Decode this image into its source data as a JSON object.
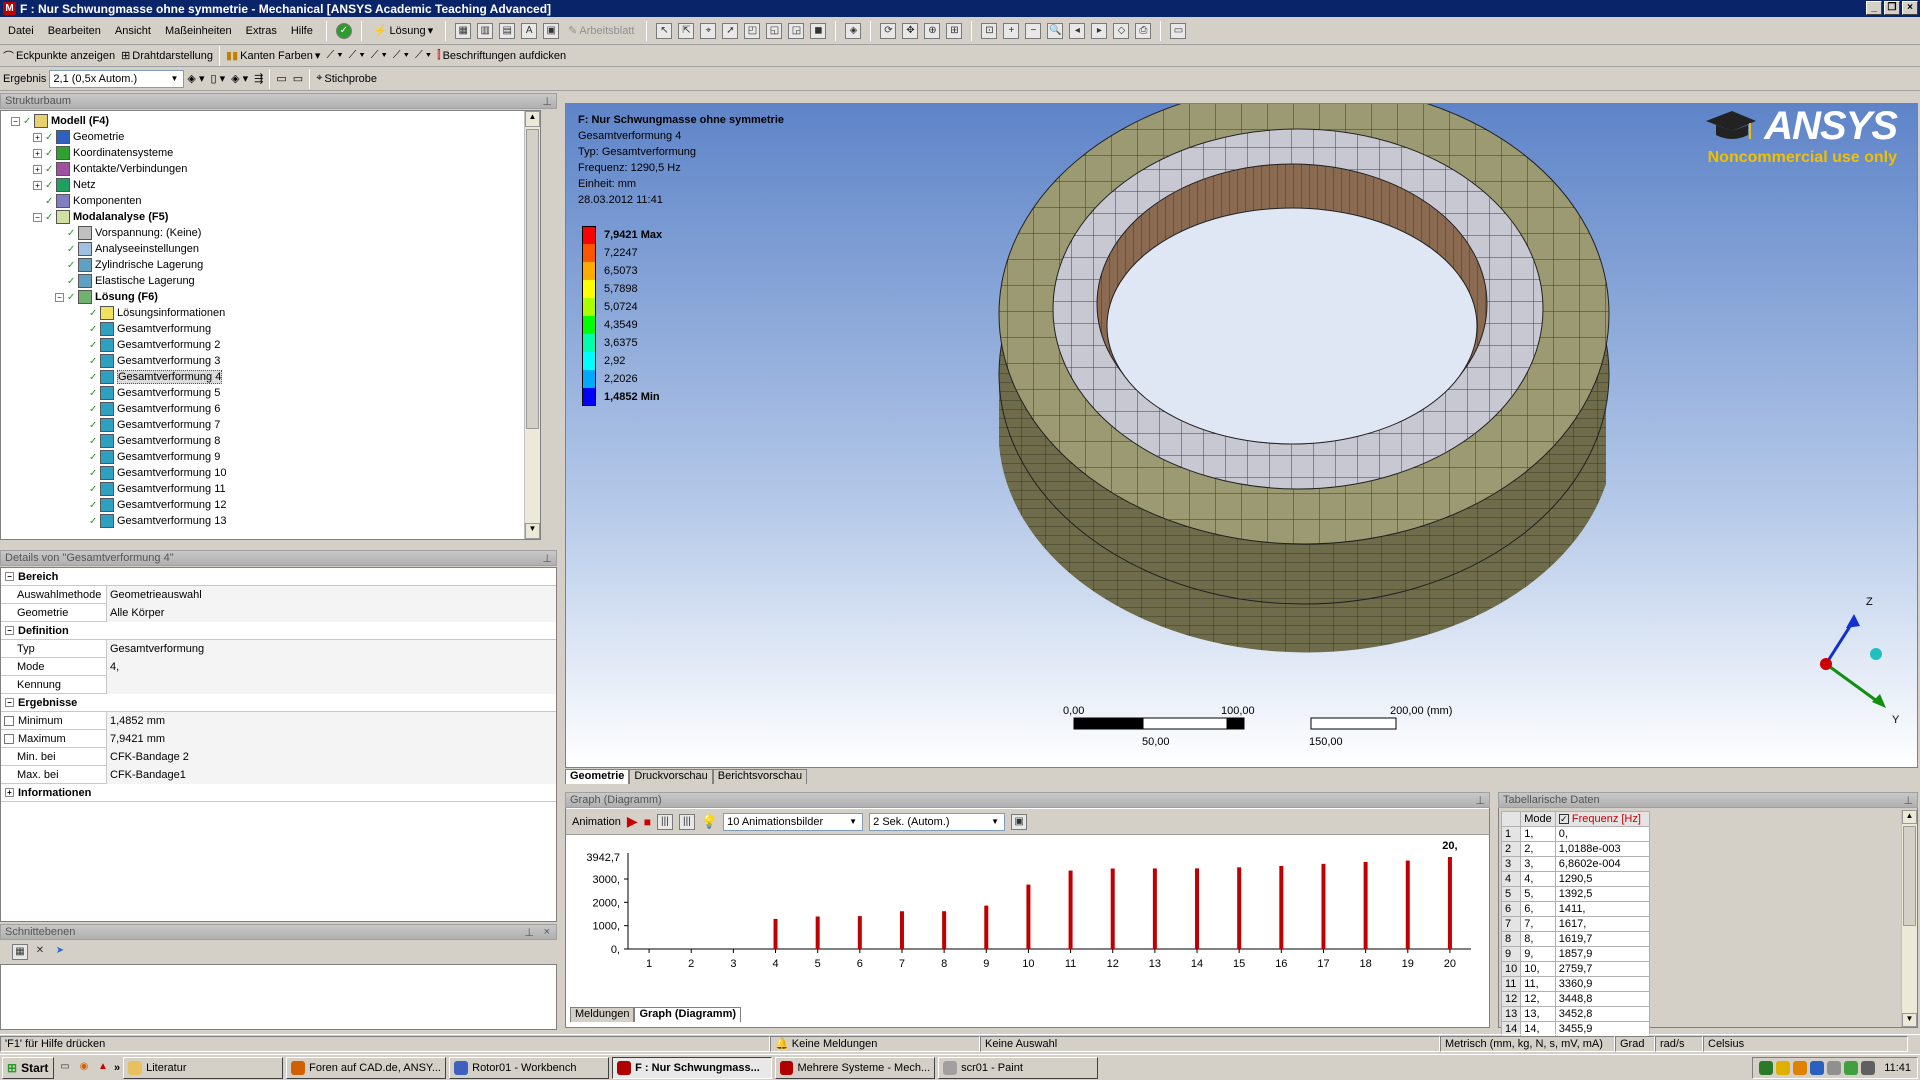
{
  "window": {
    "title": "F : Nur Schwungmasse ohne symmetrie - Mechanical [ANSYS Academic Teaching Advanced]"
  },
  "menu": [
    "Datei",
    "Bearbeiten",
    "Ansicht",
    "Maßeinheiten",
    "Extras",
    "Hilfe"
  ],
  "toolbar1": {
    "loesung": "Lösung",
    "arbeitsblatt": "Arbeitsblatt"
  },
  "toolbar2": {
    "eckpunkte": "Eckpunkte anzeigen",
    "drahtdarstellung": "Drahtdarstellung",
    "kanten_farben": "Kanten Farben",
    "beschriftungen": "Beschriftungen aufdicken"
  },
  "toolbar3": {
    "ergebnis_label": "Ergebnis",
    "ergebnis_value": "2,1 (0,5x Autom.)",
    "stichprobe": "Stichprobe"
  },
  "tree": {
    "header": "Strukturbaum",
    "items": [
      {
        "label": "Modell (F4)",
        "bold": true,
        "level": 0,
        "exp": "−",
        "icon": "model"
      },
      {
        "label": "Geometrie",
        "level": 1,
        "exp": "+",
        "icon": "geometry"
      },
      {
        "label": "Koordinatensysteme",
        "level": 1,
        "exp": "+",
        "icon": "coordinate"
      },
      {
        "label": "Kontakte/Verbindungen",
        "level": 1,
        "exp": "+",
        "icon": "contact"
      },
      {
        "label": "Netz",
        "level": 1,
        "exp": "+",
        "icon": "mesh"
      },
      {
        "label": "Komponenten",
        "level": 1,
        "exp": "",
        "icon": "component"
      },
      {
        "label": "Modalanalyse (F5)",
        "bold": true,
        "level": 1,
        "exp": "−",
        "icon": "modal"
      },
      {
        "label": "Vorspannung: (Keine)",
        "level": 2,
        "exp": "",
        "icon": "prestress"
      },
      {
        "label": "Analyseeinstellungen",
        "level": 2,
        "exp": "",
        "icon": "settings"
      },
      {
        "label": "Zylindrische Lagerung",
        "level": 2,
        "exp": "",
        "icon": "support"
      },
      {
        "label": "Elastische Lagerung",
        "level": 2,
        "exp": "",
        "icon": "support"
      },
      {
        "label": "Lösung (F6)",
        "bold": true,
        "level": 2,
        "exp": "−",
        "icon": "solution"
      },
      {
        "label": "Lösungsinformationen",
        "level": 3,
        "exp": "",
        "icon": "info"
      },
      {
        "label": "Gesamtverformung",
        "level": 3,
        "exp": "",
        "icon": "result"
      },
      {
        "label": "Gesamtverformung 2",
        "level": 3,
        "exp": "",
        "icon": "result"
      },
      {
        "label": "Gesamtverformung 3",
        "level": 3,
        "exp": "",
        "icon": "result"
      },
      {
        "label": "Gesamtverformung 4",
        "level": 3,
        "exp": "",
        "icon": "result",
        "selected": true
      },
      {
        "label": "Gesamtverformung 5",
        "level": 3,
        "exp": "",
        "icon": "result"
      },
      {
        "label": "Gesamtverformung 6",
        "level": 3,
        "exp": "",
        "icon": "result"
      },
      {
        "label": "Gesamtverformung 7",
        "level": 3,
        "exp": "",
        "icon": "result"
      },
      {
        "label": "Gesamtverformung 8",
        "level": 3,
        "exp": "",
        "icon": "result"
      },
      {
        "label": "Gesamtverformung 9",
        "level": 3,
        "exp": "",
        "icon": "result"
      },
      {
        "label": "Gesamtverformung 10",
        "level": 3,
        "exp": "",
        "icon": "result"
      },
      {
        "label": "Gesamtverformung 11",
        "level": 3,
        "exp": "",
        "icon": "result"
      },
      {
        "label": "Gesamtverformung 12",
        "level": 3,
        "exp": "",
        "icon": "result"
      },
      {
        "label": "Gesamtverformung 13",
        "level": 3,
        "exp": "",
        "icon": "result"
      }
    ]
  },
  "details": {
    "header": "Details von \"Gesamtverformung 4\"",
    "groups": [
      {
        "title": "Bereich",
        "rows": [
          {
            "k": "Auswahlmethode",
            "v": "Geometrieauswahl"
          },
          {
            "k": "Geometrie",
            "v": "Alle Körper"
          }
        ]
      },
      {
        "title": "Definition",
        "rows": [
          {
            "k": "Typ",
            "v": "Gesamtverformung"
          },
          {
            "k": "Mode",
            "v": "4,"
          },
          {
            "k": "Kennung",
            "v": ""
          }
        ]
      },
      {
        "title": "Ergebnisse",
        "rows": [
          {
            "k": "Minimum",
            "v": "1,4852 mm",
            "check": true
          },
          {
            "k": "Maximum",
            "v": "7,9421 mm",
            "check": true
          },
          {
            "k": "Min. bei",
            "v": "CFK-Bandage 2"
          },
          {
            "k": "Max. bei",
            "v": "CFK-Bandage1"
          }
        ]
      },
      {
        "title": "Informationen",
        "rows": [],
        "collapsed": true
      }
    ]
  },
  "schnittebenen": {
    "header": "Schnittebenen"
  },
  "viewport": {
    "title": "F: Nur Schwungmasse ohne symmetrie",
    "lines": [
      "Gesamtverformung 4",
      "Typ: Gesamtverformung",
      "Frequenz: 1290,5 Hz",
      "Einheit: mm",
      "28.03.2012 11:41"
    ],
    "legend": [
      {
        "value": "7,9421 Max",
        "color": "#ff0000",
        "bold": true
      },
      {
        "value": "7,2247",
        "color": "#ff5500"
      },
      {
        "value": "6,5073",
        "color": "#ffaa00"
      },
      {
        "value": "5,7898",
        "color": "#ffff00"
      },
      {
        "value": "5,0724",
        "color": "#aaff00"
      },
      {
        "value": "4,3549",
        "color": "#00ff00"
      },
      {
        "value": "3,6375",
        "color": "#00ffaa"
      },
      {
        "value": "2,92",
        "color": "#00ffff"
      },
      {
        "value": "2,2026",
        "color": "#00aaff"
      },
      {
        "value": "1,4852 Min",
        "color": "#0000ff",
        "bold": true
      }
    ],
    "logo": "ANSYS",
    "logo_sub": "Noncommercial use only",
    "scale": {
      "l0": "0,00",
      "l100": "100,00",
      "l200": "200,00 (mm)",
      "l50": "50,00",
      "l150": "150,00"
    },
    "axes": {
      "z": "Z",
      "y": "Y"
    }
  },
  "viewtabs": [
    "Geometrie",
    "Druckvorschau",
    "Berichtsvorschau"
  ],
  "graph": {
    "header": "Graph (Diagramm)",
    "animation": "Animation",
    "frames": "10 Animationsbilder",
    "duration": "2 Sek. (Autom.)",
    "tabs": [
      "Meldungen",
      "Graph (Diagramm)"
    ],
    "ytop_label": "3942,7",
    "max_label": "20,"
  },
  "chart_data": {
    "type": "bar",
    "categories": [
      "1",
      "2",
      "3",
      "4",
      "5",
      "6",
      "7",
      "8",
      "9",
      "10",
      "11",
      "12",
      "13",
      "14",
      "15",
      "16",
      "17",
      "18",
      "19",
      "20"
    ],
    "values": [
      0,
      0.010188,
      0.00068602,
      1290.5,
      1392.5,
      1411,
      1617,
      1619.7,
      1857.9,
      2759.7,
      3360.9,
      3448.8,
      3452.8,
      3455,
      3500,
      3560,
      3650,
      3730,
      3790,
      3942.7
    ],
    "y_ticks": [
      "0,",
      "1000,",
      "2000,",
      "3000,"
    ],
    "ylim": [
      0,
      3942.7
    ],
    "color": "#c00000"
  },
  "tabular": {
    "header": "Tabellarische Daten",
    "col_mode": "Mode",
    "col_freq": "Frequenz [Hz]",
    "rows": [
      [
        "1",
        "1,",
        "0,"
      ],
      [
        "2",
        "2,",
        "1,0188e-003"
      ],
      [
        "3",
        "3,",
        "6,8602e-004"
      ],
      [
        "4",
        "4,",
        "1290,5"
      ],
      [
        "5",
        "5,",
        "1392,5"
      ],
      [
        "6",
        "6,",
        "1411,"
      ],
      [
        "7",
        "7,",
        "1617,"
      ],
      [
        "8",
        "8,",
        "1619,7"
      ],
      [
        "9",
        "9,",
        "1857,9"
      ],
      [
        "10",
        "10,",
        "2759,7"
      ],
      [
        "11",
        "11,",
        "3360,9"
      ],
      [
        "12",
        "12,",
        "3448,8"
      ],
      [
        "13",
        "13,",
        "3452,8"
      ],
      [
        "14",
        "14,",
        "3455,9"
      ]
    ]
  },
  "status": {
    "help": "'F1' für Hilfe drücken",
    "meldungen": "Keine Meldungen",
    "auswahl": "Keine Auswahl",
    "units": "Metrisch (mm, kg, N, s, mV, mA)",
    "grad": "Grad",
    "rads": "rad/s",
    "celsius": "Celsius"
  },
  "taskbar": {
    "start": "Start",
    "items": [
      "Literatur",
      "Foren auf CAD.de, ANSY...",
      "Rotor01 - Workbench",
      "F : Nur Schwungmass...",
      "Mehrere Systeme - Mech...",
      "scr01 - Paint"
    ],
    "active": 3,
    "clock": "11:41"
  }
}
